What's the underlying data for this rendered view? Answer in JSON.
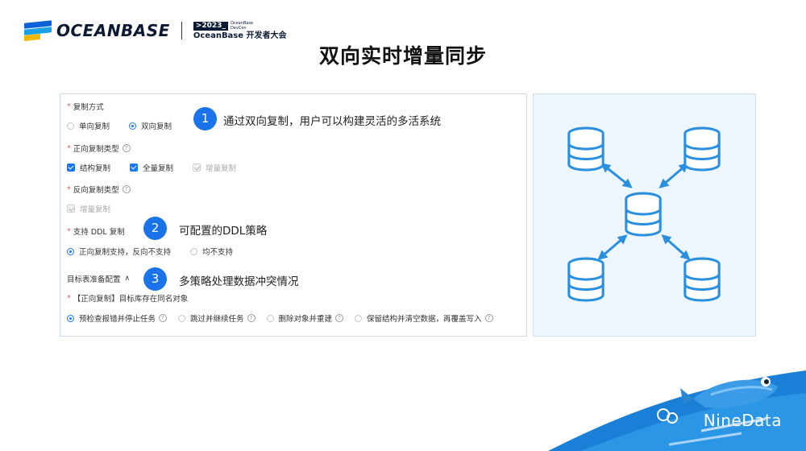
{
  "header": {
    "logo_text": "OCEANBASE",
    "devcon_year": ">2023_",
    "devcon_small_1": "OceanBase",
    "devcon_small_2": "DevCon",
    "devcon_name": "OceanBase 开发者大会"
  },
  "title": "双向实时增量同步",
  "form": {
    "replication_mode": {
      "label": "复制方式",
      "options": [
        "单向复制",
        "双向复制"
      ],
      "selected": "双向复制"
    },
    "forward_type": {
      "label": "正向复制类型",
      "options": [
        "结构复制",
        "全量复制",
        "增量复制"
      ]
    },
    "reverse_type": {
      "label": "反向复制类型",
      "options": [
        "增量复制"
      ]
    },
    "ddl": {
      "label": "支持 DDL 复制",
      "options": [
        "正向复制支持，反向不支持",
        "均不支持"
      ]
    },
    "target_prep": {
      "label": "目标表准备配置"
    },
    "same_name": {
      "label": "【正向复制】目标库存在同名对象",
      "options": [
        "预检查报错并停止任务",
        "跳过并继续任务",
        "删除对象并重建",
        "保留结构并清空数据，再覆盖写入"
      ]
    }
  },
  "callouts": [
    {
      "number": "1",
      "text": "通过双向复制，用户可以构建灵活的多活系统"
    },
    {
      "number": "2",
      "text": "可配置的DDL策略"
    },
    {
      "number": "3",
      "text": "多策略处理数据冲突情况"
    }
  ],
  "brand": "NineData",
  "colors": {
    "accent": "#1677ff",
    "badge": "#1a73e8",
    "diagram_blue": "#2b8fe0",
    "diagram_bg": "#eef6fd"
  }
}
